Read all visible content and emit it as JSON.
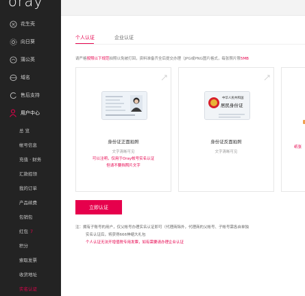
{
  "brand": {
    "logo_text": "oray"
  },
  "sidebar": {
    "nav": [
      {
        "label": "花生壳",
        "icon": "peanut-shell-icon"
      },
      {
        "label": "向日葵",
        "icon": "sunflower-icon"
      },
      {
        "label": "蒲公英",
        "icon": "dandelion-icon"
      },
      {
        "label": "域名",
        "icon": "globe-icon"
      },
      {
        "label": "售后支持",
        "icon": "support-icon"
      },
      {
        "label": "用户中心",
        "icon": "user-icon"
      }
    ],
    "sub_items": [
      {
        "label": "总 览"
      },
      {
        "label": "帐号信息"
      },
      {
        "label": "充值 · 财务"
      },
      {
        "label": "汇款招领"
      },
      {
        "label": "我的订单"
      },
      {
        "label": "产品续费"
      },
      {
        "label": "包销包"
      },
      {
        "label": "红包",
        "badge": "7"
      },
      {
        "label": "积分"
      },
      {
        "label": "索取发票"
      },
      {
        "label": "收货地址"
      },
      {
        "label": "实名认证"
      }
    ],
    "active_nav": "用户中心",
    "current_sub": "实名认证"
  },
  "tabs": [
    {
      "label": "个人认证"
    },
    {
      "label": "企业认证"
    }
  ],
  "notice": {
    "prefix": "请严格",
    "highlight": "按照以下规范",
    "suffix": "拍照以免被打回，资料准备齐全后提交办理（JPG或PNG图片格式，每张照片限",
    "limit": "5MB"
  },
  "cards": [
    {
      "title": "身份证正面拍照",
      "hint": "文字清晰可见",
      "red_lines": [
        "可以注明，仅用于Oray帐号实名认证",
        "但请不要挡照片文字"
      ]
    },
    {
      "title": "身份证反面拍照",
      "hint": "文字清晰可见",
      "id_title_line1": "中华人民共和国",
      "id_title_line2": "居民身份证"
    },
    {
      "red_partial": "纸张"
    }
  ],
  "submit_label": "立即认证",
  "notes": {
    "line1": "注：拥有子账号的用户，仅父帐号办理实名认证即可（代理商除外，代理商的父帐号、子帐号需各自单独",
    "line2": "实名认证后，将获得666伸缩大礼包",
    "line3": "个人认证无法开增值税专用发票，如有需要请办理企业认证"
  },
  "colors": {
    "accent": "#e6004c",
    "sidebar_bg": "#232323"
  }
}
